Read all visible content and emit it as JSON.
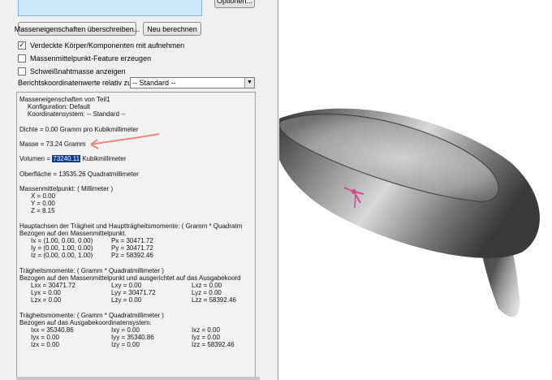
{
  "dialog": {
    "options_label": "Optionen...",
    "override_label": "Masseneigenschaften überschreiben...",
    "recalc_label": "Neu berechnen",
    "checkboxes": [
      {
        "label": "Verdeckte Körper/Komponenten mit aufnehmen",
        "checked": true,
        "mark": "✓"
      },
      {
        "label": "Massenmittelpunkt-Feature erzeugen",
        "checked": false,
        "mark": ""
      },
      {
        "label": "Schweißnahtmasse anzeigen",
        "checked": false,
        "mark": ""
      }
    ],
    "coord_label": "Berichtskoordinatenwerte relativ zu:",
    "coord_value": "-- Standard --"
  },
  "results": {
    "header": "Masseneigenschaften von Teil1",
    "config": "Konfiguration: Default",
    "coord_system": "Koordinatensystem: -- Standard --",
    "density": "Dichte = 0.00 Gramm pro Kubikmillimeter",
    "mass": "Masse = 73.24 Gramm",
    "volume_label": "Volumen = ",
    "volume_value": "73240.11",
    "volume_unit": " Kubikmillimeter",
    "surface": "Oberfläche = 13535.26  Quadratmillimeter",
    "com_header": "Massenmittelpunkt: ( Millimeter )",
    "com_x": "X = 0.00",
    "com_y": "Y = 0.00",
    "com_z": "Z = 8.15",
    "principal_header": "Hauptachsen der Trägheit und Hauptträgheitsmomente: ( Gramm *  Quadratm",
    "principal_sub": "Bezogen auf den Massenmittelpunkt.",
    "ix": "Ix = (1.00,  0.00,  0.00)",
    "px": "Px = 30471.72",
    "iy": "Iy = (0.00,  1.00,  0.00)",
    "py": "Py = 30471.72",
    "iz": "Iz = (0.00,  0.00,  1.00)",
    "pz": "Pz = 58392.46",
    "moi1_header": "Trägheitsmomente: ( Gramm *  Quadratmillimeter )",
    "moi1_sub": "Bezogen auf den Massenmittelpunkt und ausgerichtet auf das Ausgabekoord",
    "moi1_rows": [
      [
        "Lxx = 30471.72",
        "Lxy = 0.00",
        "Lxz = 0.00"
      ],
      [
        "Lyx = 0.00",
        "Lyy = 30471.72",
        "Lyz = 0.00"
      ],
      [
        "Lzx = 0.00",
        "Lzy = 0.00",
        "Lzz = 58392.46"
      ]
    ],
    "moi2_header": "Trägheitsmomente: ( Gramm *  Quadratmillimeter )",
    "moi2_sub": "Bezogen auf das Ausgabekoordinatensystem.",
    "moi2_rows": [
      [
        "Ixx = 35340.86",
        "Ixy = 0.00",
        "Ixz = 0.00"
      ],
      [
        "Iyx = 0.00",
        "Iyy = 35340.86",
        "Iyz = 0.00"
      ],
      [
        "Izx = 0.00",
        "Izy = 0.00",
        "Izz = 58392.46"
      ]
    ]
  },
  "colors": {
    "annotation_arrow": "#e88a7a",
    "highlight": "#0a3a8c",
    "triad": "#d04a8a"
  },
  "icons": [
    "checkbox-checked-icon",
    "dropdown-arrow-icon",
    "coordinate-triad-icon",
    "annotation-arrow-icon"
  ]
}
